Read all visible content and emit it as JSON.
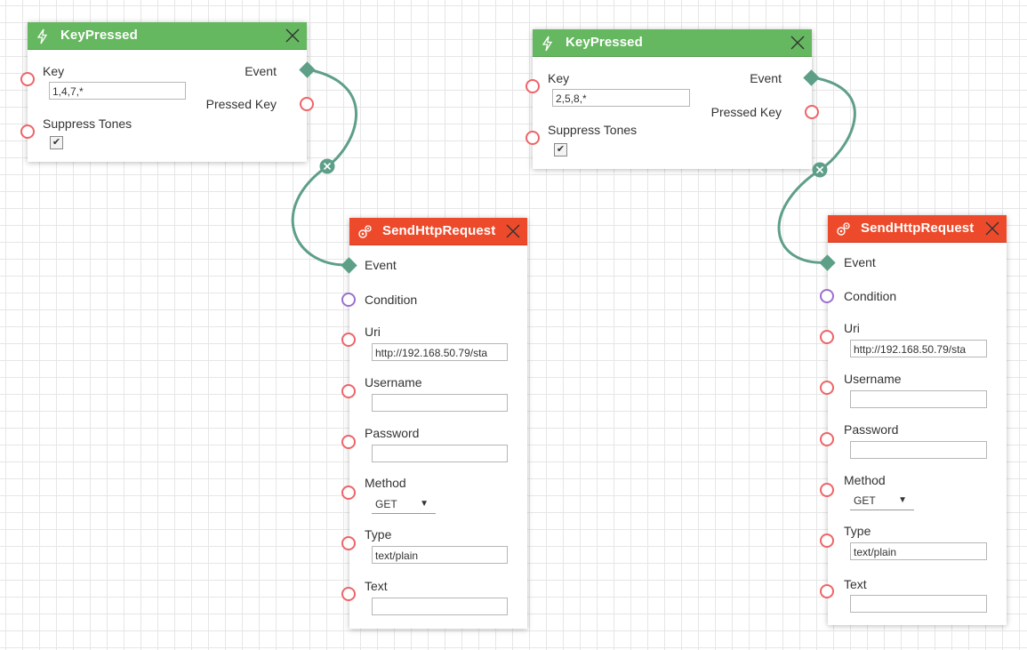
{
  "nodes": [
    {
      "title": "KeyPressed",
      "key_label": "Key",
      "key_value": "1,4,7,*",
      "suppress_label": "Suppress Tones",
      "suppress_checked": true,
      "event_label": "Event",
      "pressed_key_label": "Pressed Key"
    },
    {
      "title": "KeyPressed",
      "key_label": "Key",
      "key_value": "2,5,8,*",
      "suppress_label": "Suppress Tones",
      "suppress_checked": true,
      "event_label": "Event",
      "pressed_key_label": "Pressed Key"
    },
    {
      "title": "SendHttpRequest",
      "event_label": "Event",
      "condition_label": "Condition",
      "uri_label": "Uri",
      "uri_value": "http://192.168.50.79/sta",
      "username_label": "Username",
      "username_value": "",
      "password_label": "Password",
      "password_value": "",
      "method_label": "Method",
      "method_value": "GET",
      "type_label": "Type",
      "type_value": "text/plain",
      "text_label": "Text",
      "text_value": ""
    },
    {
      "title": "SendHttpRequest",
      "event_label": "Event",
      "condition_label": "Condition",
      "uri_label": "Uri",
      "uri_value": "http://192.168.50.79/sta",
      "username_label": "Username",
      "username_value": "",
      "password_label": "Password",
      "password_value": "",
      "method_label": "Method",
      "method_value": "GET",
      "type_label": "Type",
      "type_value": "text/plain",
      "text_label": "Text",
      "text_value": ""
    }
  ],
  "icons": {
    "trigger": "lightning-icon",
    "action": "gears-icon",
    "close": "close-icon",
    "dropdown": "caret-down-icon",
    "check": "✔"
  },
  "colors": {
    "trigger_header": "#65b760",
    "action_header": "#ed4a2b",
    "wire": "#5e9f88",
    "port": "#ee6468",
    "condition_port": "#9b6fd0"
  }
}
